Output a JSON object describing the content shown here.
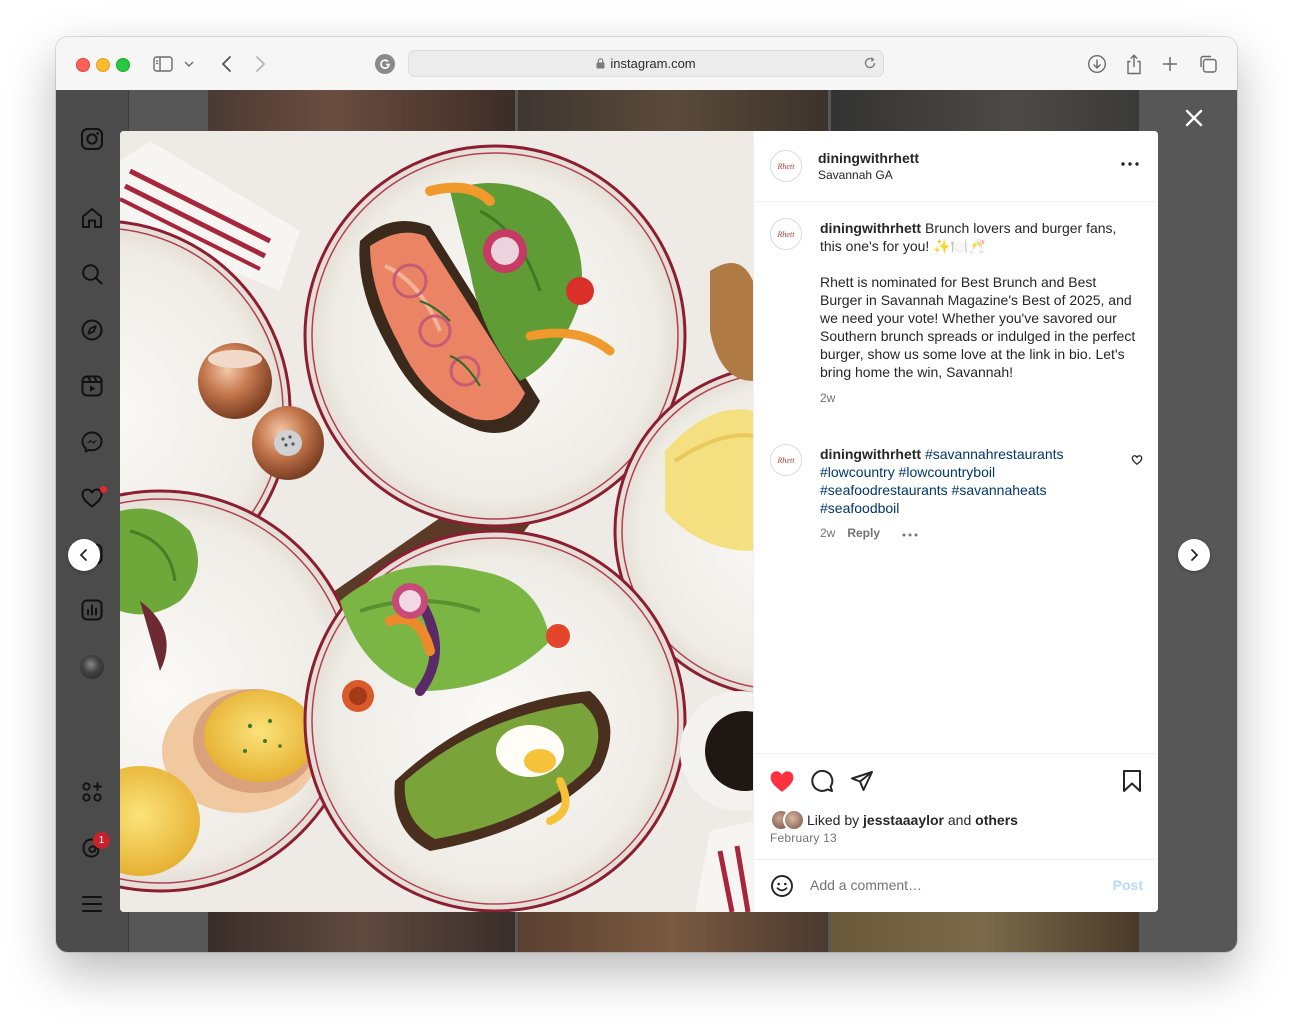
{
  "browser": {
    "url": "instagram.com"
  },
  "post": {
    "username": "diningwithrhett",
    "location": "Savannah GA",
    "caption": {
      "username": "diningwithrhett",
      "line1": "Brunch lovers and burger fans, this one's for you! ✨🍽️🥂",
      "line2": "Rhett is nominated for Best Brunch and Best Burger in Savannah Magazine's Best of 2025, and we need your vote! Whether you've savored our Southern brunch spreads or indulged in the perfect burger, show us some love at the link in bio. Let's bring home the win, Savannah!",
      "age": "2w"
    },
    "comment": {
      "username": "diningwithrhett",
      "hashtags": "#savannahrestaurants #lowcountry #lowcountryboil #seafoodrestaurants #savannaheats #seafoodboil",
      "age": "2w",
      "reply_label": "Reply"
    },
    "likes": {
      "prefix": "Liked by",
      "user": "jesstaaaylor",
      "and": "and",
      "others": "others"
    },
    "date": "February 13",
    "comment_placeholder": "Add a comment…",
    "post_label": "Post",
    "avatar_logo_text": "Rhett"
  },
  "sidebar": {
    "notifications_count": "1"
  },
  "colors": {
    "like_red": "#ff3040",
    "hashtag_blue": "#00376b",
    "post_btn": "#b3dbff",
    "overlay": "#575757"
  }
}
